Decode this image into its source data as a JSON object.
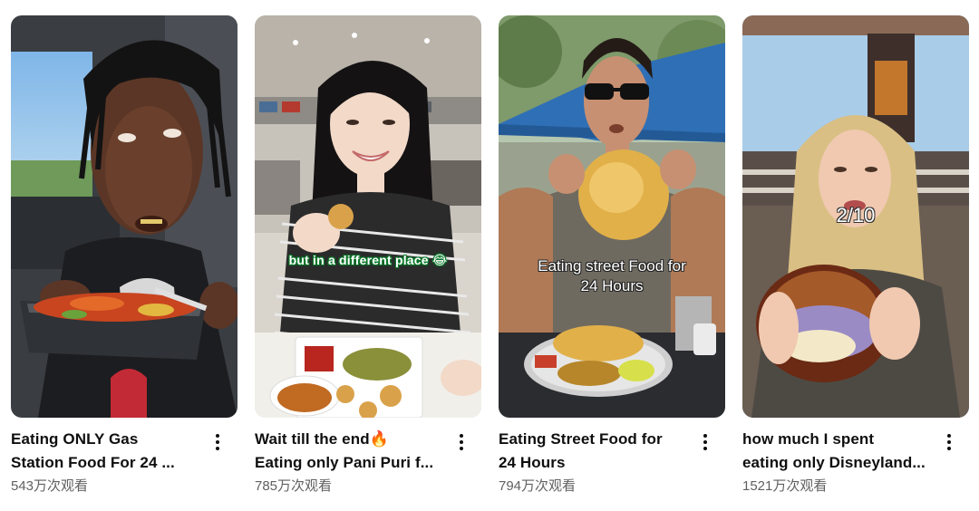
{
  "videos": [
    {
      "title_line1": "Eating ONLY Gas",
      "title_line2": "Station Food For 24 ...",
      "views": "543万次观看",
      "overlay": "",
      "more_icon": "more-vertical-icon"
    },
    {
      "title_line1": "Wait till the end🔥",
      "title_line2": "Eating only Pani Puri f...",
      "views": "785万次观看",
      "overlay": "but in a different place 😂",
      "more_icon": "more-vertical-icon"
    },
    {
      "title_line1": "Eating Street Food for",
      "title_line2": "24 Hours",
      "views": "794万次观看",
      "overlay_line1": "Eating street Food for",
      "overlay_line2": "24 Hours",
      "more_icon": "more-vertical-icon"
    },
    {
      "title_line1": "how much I spent",
      "title_line2": "eating only Disneyland...",
      "views": "1521万次观看",
      "overlay": "2/10",
      "more_icon": "more-vertical-icon"
    }
  ],
  "colors": {
    "title": "#0f0f0f",
    "views": "#606060",
    "background": "#ffffff"
  }
}
